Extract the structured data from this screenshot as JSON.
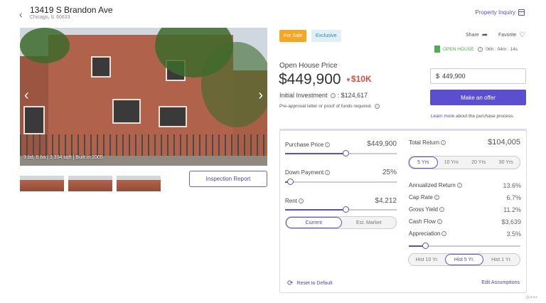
{
  "header": {
    "title": "13419 S Brandon Ave",
    "subtitle": "Chicago, IL 60633",
    "property_inquiry": "Property Inquiry"
  },
  "photo": {
    "caption": "9 bd, 6 ba | 3,304 sqft | Built in 2005",
    "inspection_report": "Inspection Report"
  },
  "tags": {
    "for_sale": "For Sale",
    "exclusive": "Exclusive"
  },
  "actions": {
    "share": "Share",
    "favorite": "Favorite"
  },
  "open_house": {
    "label": "OPEN HOUSE",
    "countdown": "06h : 04m : 14s"
  },
  "pricing": {
    "label": "Open House Price",
    "price": "$449,900",
    "drop": "$10K",
    "initial_investment_label": "Initial Investment",
    "initial_investment_value": ": $124,617",
    "preapproval": "Pre-approval letter or proof of funds required.",
    "input_prefix": "$",
    "input_value": "449,900",
    "make_offer": "Make an offer",
    "learn_more": "Learn more",
    "learn_rest": " about the purchase process."
  },
  "calculator": {
    "purchase_price": {
      "label": "Purchase Price",
      "value": "$449,900",
      "level": 0.55
    },
    "down_payment": {
      "label": "Down Payment",
      "value": "25%",
      "level": 0.05
    },
    "rent": {
      "label": "Rent",
      "value": "$4,212",
      "level": 0.55
    },
    "rent_toggle": [
      "Current",
      "Est. Market"
    ],
    "total_return": {
      "label": "Total Return",
      "value": "$104,005"
    },
    "years": [
      "5 Yrs",
      "10 Yrs",
      "20 Yrs",
      "30 Yrs"
    ],
    "metrics": [
      {
        "label": "Annualized Return",
        "value": "13.6%"
      },
      {
        "label": "Cap Rate",
        "value": "6.7%"
      },
      {
        "label": "Gross Yield",
        "value": "11.2%"
      },
      {
        "label": "Cash Flow",
        "value": "$3,639"
      },
      {
        "label": "Appreciation",
        "value": "3.5%"
      }
    ],
    "appreciation_level": 0.15,
    "hist": [
      "Hist 10 Yr.",
      "Hist 5 Yr.",
      "Hist 1 Yr."
    ],
    "reset": "Reset to Default",
    "edit": "Edit Assumptions"
  },
  "footer_mark": "::ll:×××"
}
